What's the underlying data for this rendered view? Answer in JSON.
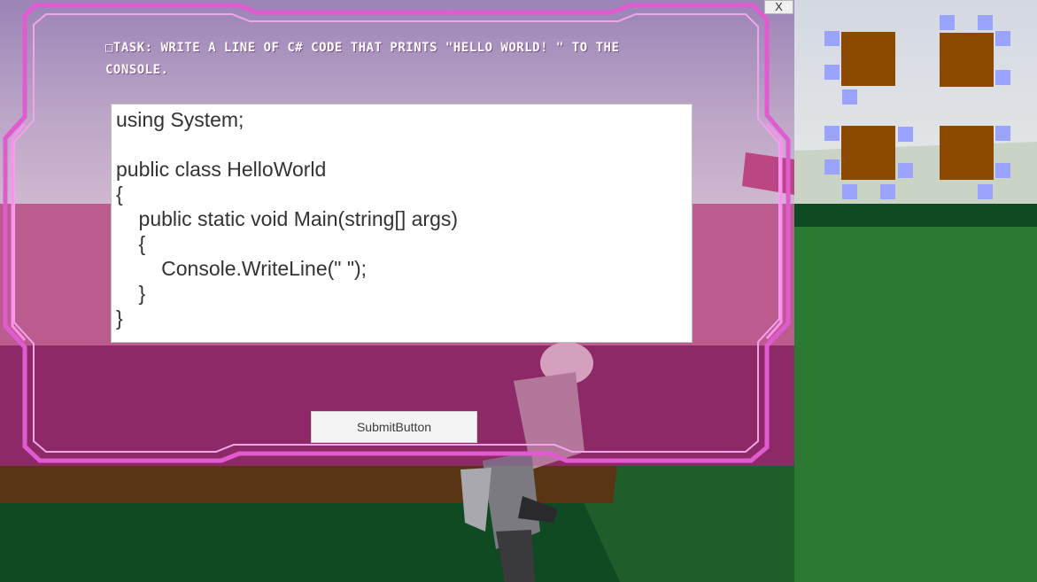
{
  "task": {
    "text": "□Task: Write a line of C# code that prints \"Hello World! \" to the console."
  },
  "editor": {
    "code": "using System;\n\npublic class HelloWorld\n{\n    public static void Main(string[] args)\n    {\n        Console.WriteLine(\" \");\n    }\n}"
  },
  "buttons": {
    "submit_label": "SubmitButton",
    "close_label": "X"
  },
  "colors": {
    "frame": "#e05ad0",
    "room": "#8b4a00",
    "node": "#9aa4ff",
    "ground": "#2c7a32"
  }
}
